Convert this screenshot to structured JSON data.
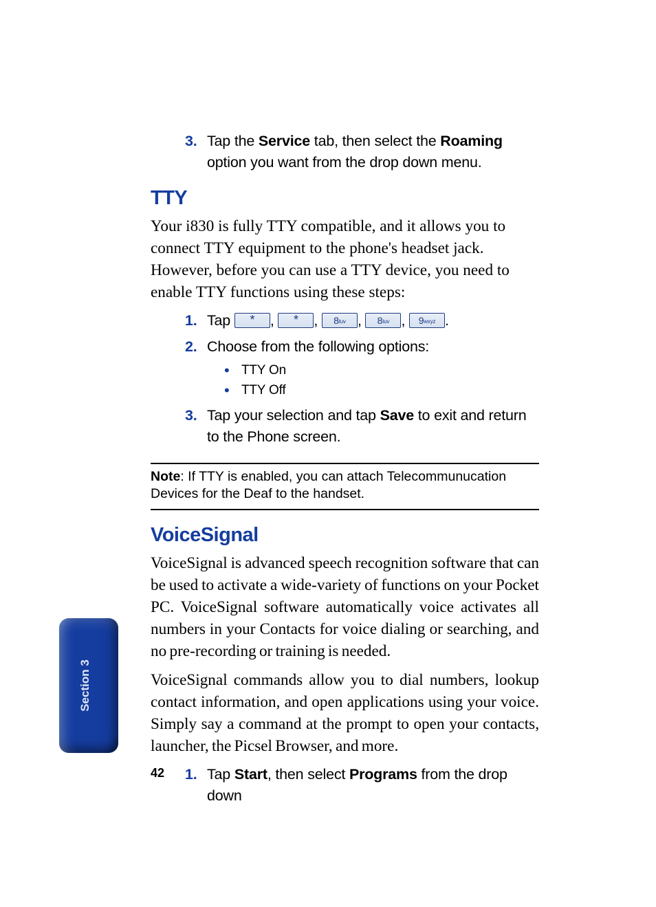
{
  "top_step3": {
    "pre": "Tap the ",
    "b1": "Service",
    "mid": " tab, then select the ",
    "b2": "Roaming",
    "post": " option you want from the drop down menu."
  },
  "tty": {
    "heading": "TTY",
    "intro": "Your i830 is fully TTY compatible, and it allows you to connect TTY equipment to the phone's headset jack. However, before you can use a TTY device, you need to enable TTY functions using these steps:",
    "step1_pre": "Tap ",
    "keys": {
      "k1": "*",
      "k2": "*",
      "k3n": "8",
      "k3s": "tuv",
      "k4n": "8",
      "k4s": "tuv",
      "k5n": "9",
      "k5s": "wxyz"
    },
    "step2": "Choose from the following options:",
    "bullet1": "TTY On",
    "bullet2": "TTY Off",
    "step3_pre": "Tap your selection and tap ",
    "step3_b": "Save",
    "step3_post": " to exit and return to the Phone screen."
  },
  "note": {
    "label": "Note",
    "text": ": If TTY is enabled, you can attach Telecommunucation Devices for the Deaf to the handset."
  },
  "vs": {
    "heading": "VoiceSignal",
    "p1": "VoiceSignal is advanced speech recognition software that can be used to activate a wide-variety of functions on your Pocket PC. VoiceSignal software automatically voice activates all numbers in your Contacts for voice dialing or searching, and no pre-recording or training is needed.",
    "p2": "VoiceSignal commands allow you to dial numbers, lookup contact information, and open applications using your voice. Simply say a command at the prompt to open your contacts, launcher, the Picsel Browser, and more.",
    "step1_pre": "Tap ",
    "step1_b1": "Start",
    "step1_mid": ", then select ",
    "step1_b2": "Programs",
    "step1_post": " from the drop down"
  },
  "section_tab": "Section 3",
  "page_number": "42",
  "markers": {
    "m1": "1.",
    "m2": "2.",
    "m3": "3."
  },
  "punct": {
    "comma": ", ",
    "period": "."
  }
}
